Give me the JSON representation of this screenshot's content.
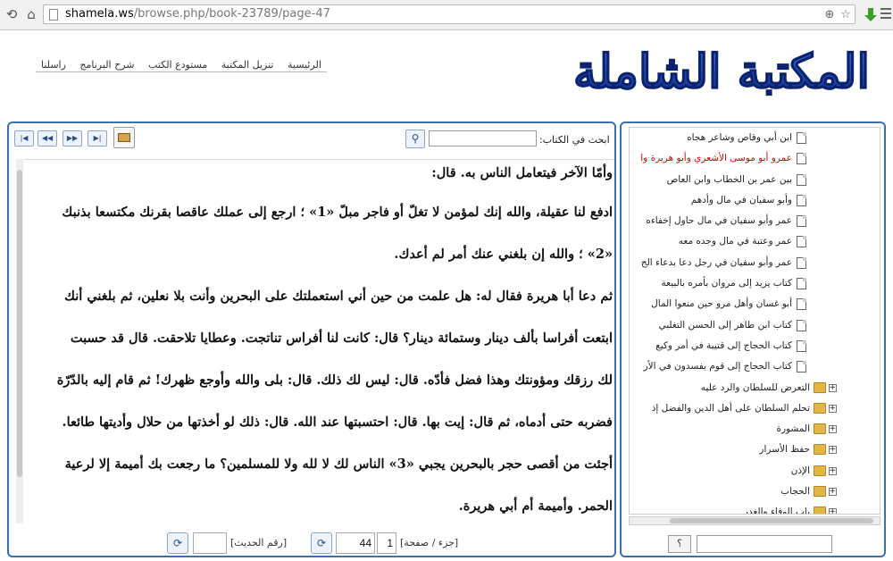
{
  "browser": {
    "url_domain": "shamela.ws",
    "url_path": "/browse.php/book-23789/page-47",
    "icons": [
      "back-icon",
      "refresh-icon",
      "home-icon",
      "zoom-icon",
      "star-icon",
      "download-icon",
      "menu-icon"
    ]
  },
  "header": {
    "nav": [
      "الرئيسية",
      "تنزيل المكتبة",
      "مستودع الكتب",
      "شرح البرنامج",
      "راسلنا"
    ],
    "logo_text": "المكتبة الشاملة",
    "logo_color": "#1a3f9e"
  },
  "toolbar": {
    "search_label": "ابحث في الكتاب:",
    "search_value": "",
    "search_icon": "magnifier-icon",
    "first_icon": "first-page-icon",
    "prev_icon": "prev-page-icon",
    "next_icon": "next-page-icon",
    "last_icon": "last-page-icon",
    "print_icon": "print-icon"
  },
  "text_lines": [
    "وأمّا الآخر فيتعامل الناس به. قال:",
    "ادفع لنا عقيلة، والله إنك لمؤمن لا تغلّ أو فاجر مبلّ «1» ؛ ارجع إلى عملك عاقصا بقرنك مكتسعا بذنبك",
    "«2» ؛ والله إن بلغني عنك أمر لم أعدك.",
    "ثم دعا أبا هريرة فقال له: هل علمت من حين أني استعملتك على البحرين وأنت بلا نعلين، ثم بلغني أنك",
    "ابتعت أفراسا بألف دينار وستمائة دينار؟ قال: كانت لنا أفراس تناتجت. وعطايا تلاحقت. قال قد حسبت",
    "لك رزقك ومؤونتك وهذا فضل فأدّه. قال: ليس لك ذلك. قال: بلى والله وأوجع ظهرك! ثم قام إليه بالدّرّة",
    "فضربه حتى أدماه، ثم قال: إيت بها. قال: احتسبتها عند الله. قال: ذلك لو أخذتها من حلال وأديتها طائعا.",
    "أجئت من أقصى حجر بالبحرين يجبي «3» الناس لك لا لله ولا للمسلمين؟ ما رجعت بك أميمة إلا لرعية",
    "الحمر. وأميمة أم أبي هريرة."
  ],
  "footer": {
    "part_label": "[جزء / صفحة]",
    "part_value": "1",
    "page_value": "44",
    "hadith_label": "[رقم الحديث]",
    "hadith_value": "",
    "go_icon": "go-icon"
  },
  "toc": {
    "items": [
      {
        "label": "ابن أبي وقاص وشاعر هجاه",
        "kind": "doc"
      },
      {
        "label": "عمرو أبو موسى الأشعري وأبو هريرة وا",
        "kind": "doc",
        "active": true
      },
      {
        "label": "بين عمر بن الخطاب وابن العاص",
        "kind": "doc"
      },
      {
        "label": "وأبو سفيان في مال وأدهم",
        "kind": "doc"
      },
      {
        "label": "عمر وأبو سفيان في مال حاول إخفاءه",
        "kind": "doc"
      },
      {
        "label": "عمر وعتبة في مال وجده معه",
        "kind": "doc"
      },
      {
        "label": "عمر وأبو سفيان في رجل دعا بدعاء الج",
        "kind": "doc"
      },
      {
        "label": "كتاب يزيد إلى مروان بأمره بالبيعة",
        "kind": "doc"
      },
      {
        "label": "أبو غسان وأهل مرو حين منعوا المال",
        "kind": "doc"
      },
      {
        "label": "كتاب ابن طاهر إلى الحسن التغلبي",
        "kind": "doc"
      },
      {
        "label": "كتاب الحجاج إلى قتيبة في أمر وكيع",
        "kind": "doc"
      },
      {
        "label": "كتاب الحجاج إلى قوم يفسدون في الأر",
        "kind": "doc"
      },
      {
        "label": "التعرض للسلطان والرد عليه",
        "kind": "folder"
      },
      {
        "label": "تحلم السلطان على أهل الدين والفضل إذ",
        "kind": "folder"
      },
      {
        "label": "المشورة",
        "kind": "folder"
      },
      {
        "label": "حفظ الأسرار",
        "kind": "folder"
      },
      {
        "label": "الإذن",
        "kind": "folder"
      },
      {
        "label": "الحجاب",
        "kind": "folder"
      },
      {
        "label": "باب الوفاء والغدر",
        "kind": "folder"
      }
    ],
    "search_button": "؟",
    "search_value": ""
  },
  "colors": {
    "panel_border": "#3c6fb0",
    "active_item": "#e00000"
  }
}
